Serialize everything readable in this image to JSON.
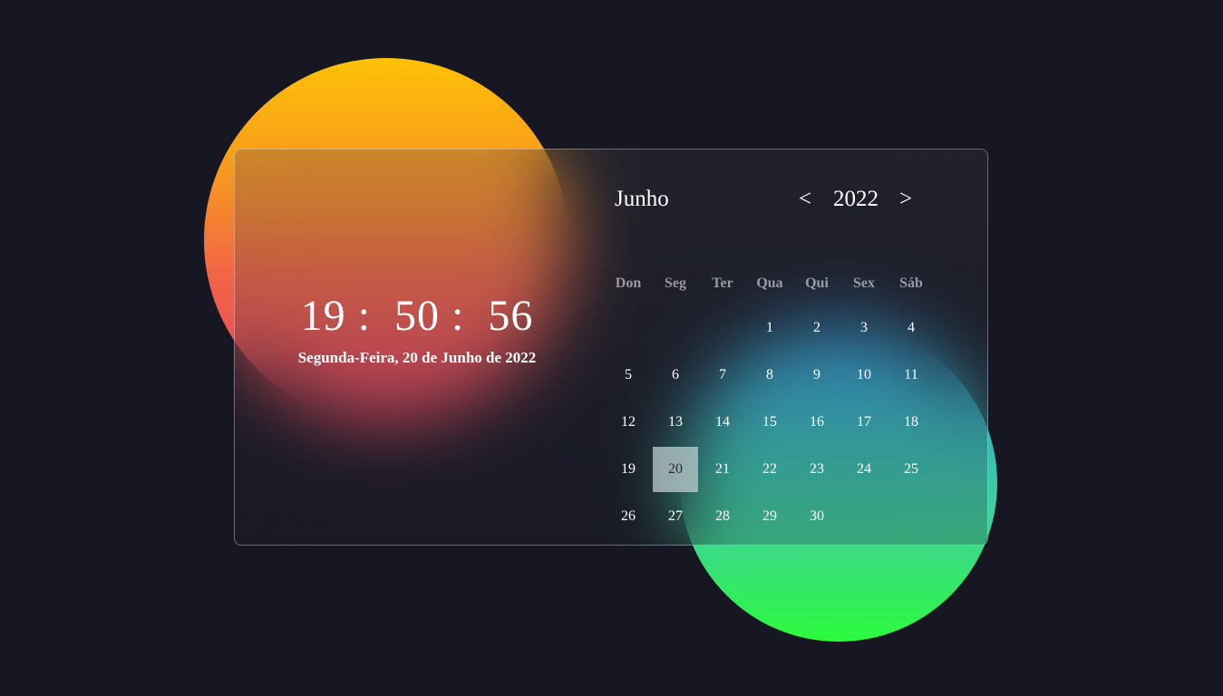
{
  "clock": {
    "time": "19 :  50 :  56",
    "date": "Segunda-Feira, 20 de Junho de 2022"
  },
  "calendar": {
    "month": "Junho",
    "year": "2022",
    "prev_label": "<",
    "next_label": ">",
    "weekdays": [
      "Don",
      "Seg",
      "Ter",
      "Qua",
      "Qui",
      "Sex",
      "Sáb"
    ],
    "first_weekday_index": 3,
    "days_in_month": 30,
    "selected_day": 20
  },
  "colors": {
    "background": "#161722",
    "warm_gradient": [
      "#ffc107",
      "#e43f63"
    ],
    "cool_gradient": [
      "#2f8fd8",
      "#2cfa3c"
    ],
    "today_highlight": "#bdcfcf"
  }
}
